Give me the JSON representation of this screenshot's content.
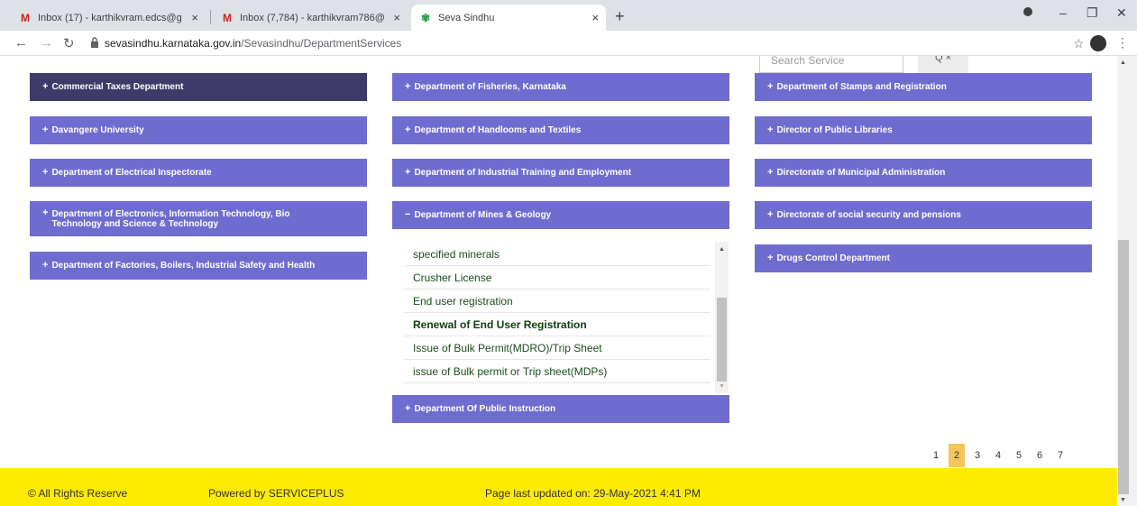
{
  "browser": {
    "tabs": [
      {
        "title": "Inbox (17) - karthikvram.edcs@g",
        "icon": "gmail-icon"
      },
      {
        "title": "Inbox (7,784) - karthikvram786@",
        "icon": "gmail-icon"
      },
      {
        "title": "Seva Sindhu",
        "icon": "seva-sindhu-icon"
      }
    ],
    "tab_close": "×",
    "new_tab": "+",
    "url_host": "sevasindhu.karnataka.gov.in",
    "url_path": "/Sevasindhu/DepartmentServices",
    "window_controls": {
      "minimize": "–",
      "restore": "❐",
      "close": "✕"
    }
  },
  "search": {
    "placeholder": "Search Service",
    "button": "Q ×"
  },
  "departments": {
    "col1": [
      {
        "label": "Commercial Taxes Department",
        "sign": "+"
      },
      {
        "label": "Davangere University",
        "sign": "+"
      },
      {
        "label": "Department of Electrical Inspectorate",
        "sign": "+"
      },
      {
        "label": "Department of Electronics, Information Technology, Bio Technology and Science & Technology",
        "sign": "+"
      },
      {
        "label": "Department of Factories, Boilers, Industrial Safety and Health",
        "sign": "+"
      }
    ],
    "col2": [
      {
        "label": "Department of Fisheries, Karnataka",
        "sign": "+"
      },
      {
        "label": "Department of Handlooms and Textiles",
        "sign": "+"
      },
      {
        "label": "Department of Industrial Training and Employment",
        "sign": "+"
      },
      {
        "label": "Department of Mines & Geology",
        "sign": "−"
      },
      {
        "label": "Department Of Public Instruction",
        "sign": "+"
      }
    ],
    "col3": [
      {
        "label": "Department of Stamps and Registration",
        "sign": "+"
      },
      {
        "label": "Director of Public Libraries",
        "sign": "+"
      },
      {
        "label": "Directorate of Municipal Administration",
        "sign": "+"
      },
      {
        "label": "Directorate of social security and pensions",
        "sign": "+"
      },
      {
        "label": "Drugs Control Department",
        "sign": "+"
      }
    ]
  },
  "mines_services": [
    "specified minerals",
    "Crusher License",
    "End user registration",
    "Renewal of End User Registration",
    "Issue of Bulk Permit(MDRO)/Trip Sheet",
    "issue of Bulk permit or Trip sheet(MDPs)"
  ],
  "pagination": {
    "pages": [
      "1",
      "2",
      "3",
      "4",
      "5",
      "6",
      "7"
    ],
    "current": "2"
  },
  "footer": {
    "rights": "© All Rights Reserve",
    "powered": "Powered by SERVICEPLUS",
    "updated": "Page last updated on: 29-May-2021 4:41 PM"
  },
  "colors": {
    "dept_button": "#6f6ccf",
    "dept_active": "#3e3b6b",
    "footer": "#ffeb00",
    "page_active": "#f4c55c"
  }
}
